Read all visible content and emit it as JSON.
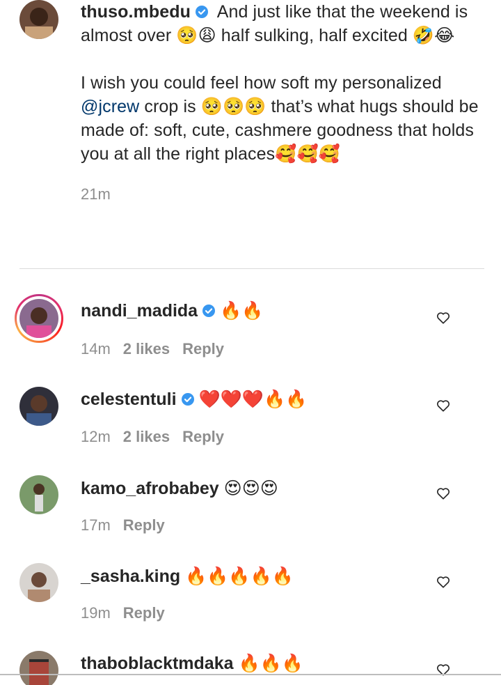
{
  "post": {
    "username": "thuso.mbedu",
    "verified": true,
    "line1": " And just like that the weekend is almost over 🥺😩 half sulking, half excited 🤣😂",
    "line2_a": "I wish you could feel how soft my personalized ",
    "mention": "@jcrew",
    "line2_b": " crop is 🥺🥺🥺 that’s what hugs should be made of: soft, cute, cashmere goodness that holds you at all the right places🥰🥰🥰",
    "time": "21m"
  },
  "comments": [
    {
      "username": "nandi_madida",
      "verified": true,
      "text": "🔥🔥",
      "time": "14m",
      "likes": "2 likes",
      "reply": "Reply",
      "story_ring": true
    },
    {
      "username": "celestentuli",
      "verified": true,
      "text": "❤️❤️❤️🔥🔥",
      "time": "12m",
      "likes": "2 likes",
      "reply": "Reply"
    },
    {
      "username": "kamo_afrobabey",
      "verified": false,
      "text": "😍😍😍",
      "time": "17m",
      "reply": "Reply"
    },
    {
      "username": "_sasha.king",
      "verified": false,
      "text": "🔥🔥🔥🔥🔥",
      "time": "19m",
      "reply": "Reply"
    },
    {
      "username": "thaboblacktmdaka",
      "verified": false,
      "text": "🔥🔥🔥"
    }
  ],
  "colors": {
    "text": "#262626",
    "secondary": "#8e8e8e",
    "link": "#00376b",
    "verified": "#3897f0",
    "divider": "#dbdbdb"
  },
  "icons": {
    "verified": "verified-badge-icon",
    "like": "heart-outline-icon"
  }
}
